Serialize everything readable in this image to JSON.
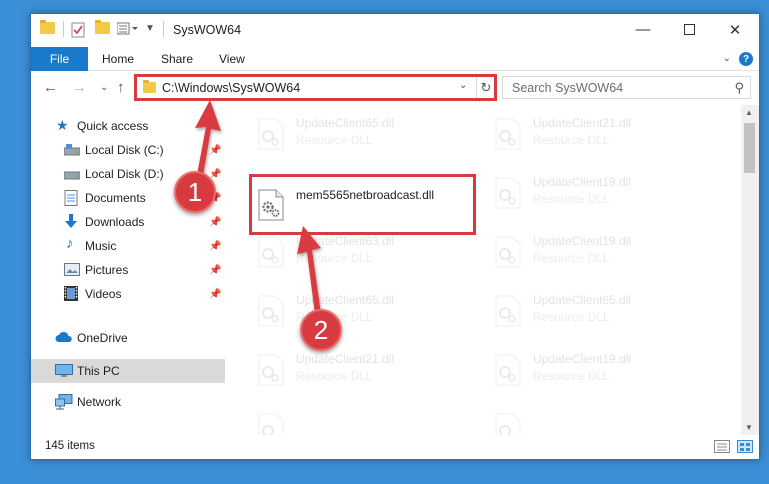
{
  "window": {
    "title": "SysWOW64"
  },
  "ribbon": {
    "file_label": "File",
    "tabs": [
      "Home",
      "Share",
      "View"
    ]
  },
  "navbar": {
    "address_path": "C:\\Windows\\SysWOW64",
    "search_placeholder": "Search SysWOW64"
  },
  "sidebar": {
    "items": [
      {
        "label": "Quick access",
        "icon": "star-icon"
      },
      {
        "label": "Local Disk (C:)",
        "icon": "drive-icon",
        "pinned": true
      },
      {
        "label": "Local Disk (D:)",
        "icon": "drive-icon",
        "pinned": true
      },
      {
        "label": "Documents",
        "icon": "documents-icon",
        "pinned": true
      },
      {
        "label": "Downloads",
        "icon": "download-icon",
        "pinned": true
      },
      {
        "label": "Music",
        "icon": "music-icon",
        "pinned": true
      },
      {
        "label": "Pictures",
        "icon": "pictures-icon",
        "pinned": true
      },
      {
        "label": "Videos",
        "icon": "videos-icon",
        "pinned": true
      },
      {
        "label": "OneDrive",
        "icon": "cloud-icon"
      },
      {
        "label": "This PC",
        "icon": "computer-icon",
        "selected": true
      },
      {
        "label": "Network",
        "icon": "network-icon"
      }
    ]
  },
  "files": {
    "highlighted": {
      "name": "mem5565netbroadcast.dll",
      "type": ""
    },
    "faded": [
      {
        "name": "UpdateClient65.dll",
        "type": "Resource DLL"
      },
      {
        "name": "UpdateClient21.dll",
        "type": "Resource DLL"
      },
      {
        "name": "UpdateClient19.dll",
        "type": "Resource DLL"
      },
      {
        "name": "UpdateClient63.dll",
        "type": "Resource DLL"
      },
      {
        "name": "UpdateClient19.dll",
        "type": "Resource DLL"
      },
      {
        "name": "UpdateClient65.dll",
        "type": "Resource DLL"
      },
      {
        "name": "UpdateClient65.dll",
        "type": "Resource DLL"
      },
      {
        "name": "UpdateClient65.dll",
        "type": "Resource DLL"
      },
      {
        "name": "UpdateClient21.dll",
        "type": "Resource DLL"
      },
      {
        "name": "UpdateClient19.dll",
        "type": "Resource DLL"
      }
    ]
  },
  "status": {
    "item_count": "145 items"
  },
  "annotations": {
    "step1": "1",
    "step2": "2",
    "color": "#d83b3f"
  },
  "colors": {
    "accent": "#1979ca",
    "desktop": "#3b8fd6",
    "selection": "#d9d9d9"
  }
}
